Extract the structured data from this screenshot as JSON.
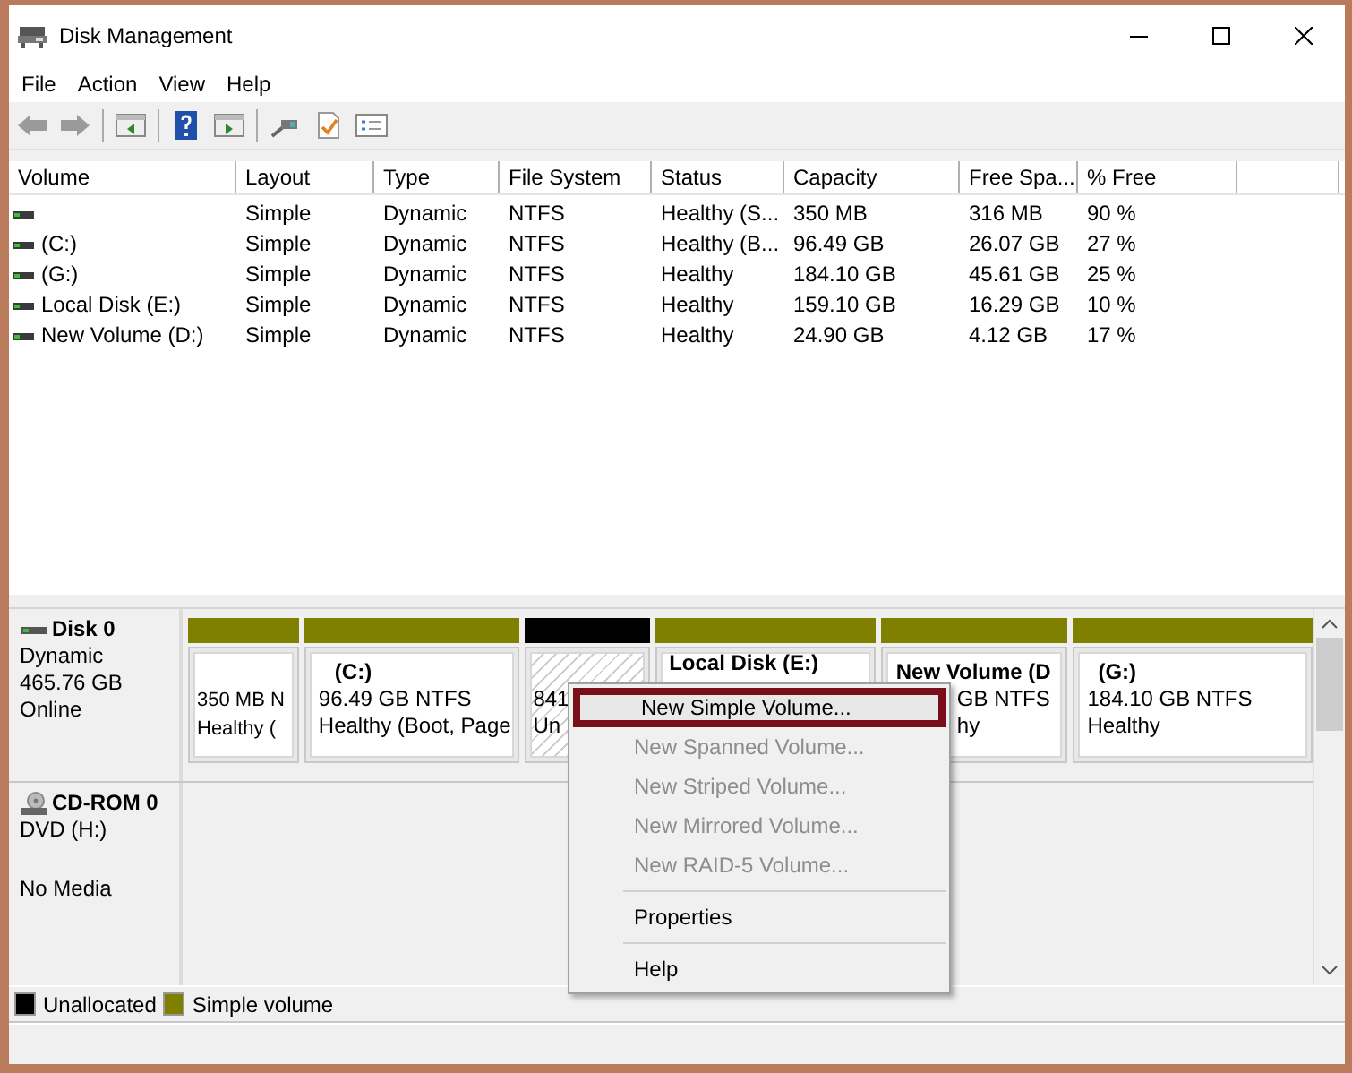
{
  "window": {
    "title": "Disk Management"
  },
  "menu": [
    "File",
    "Action",
    "View",
    "Help"
  ],
  "volume_list": {
    "columns": [
      "Volume",
      "Layout",
      "Type",
      "File System",
      "Status",
      "Capacity",
      "Free Spa...",
      "% Free"
    ],
    "rows": [
      {
        "layout": "Simple",
        "type": "Dynamic",
        "file_system": "NTFS",
        "status": "Healthy (S...",
        "capacity": "350 MB",
        "free_space": "316 MB",
        "percent_free": "90 %"
      },
      {
        "volume": " (C:)",
        "layout": "Simple",
        "type": "Dynamic",
        "file_system": "NTFS",
        "status": "Healthy (B...",
        "capacity": "96.49 GB",
        "free_space": "26.07 GB",
        "percent_free": "27 %"
      },
      {
        "volume": " (G:)",
        "layout": "Simple",
        "type": "Dynamic",
        "file_system": "NTFS",
        "status": "Healthy",
        "capacity": "184.10 GB",
        "free_space": "45.61 GB",
        "percent_free": "25 %"
      },
      {
        "volume": "Local Disk (E:)",
        "layout": "Simple",
        "type": "Dynamic",
        "file_system": "NTFS",
        "status": "Healthy",
        "capacity": "159.10 GB",
        "free_space": "16.29 GB",
        "percent_free": "10 %"
      },
      {
        "volume": "New Volume (D:)",
        "layout": "Simple",
        "type": "Dynamic",
        "file_system": "NTFS",
        "status": "Healthy",
        "capacity": "24.90 GB",
        "free_space": "4.12 GB",
        "percent_free": "17 %"
      }
    ]
  },
  "disks": [
    {
      "kind": "disk",
      "name": "Disk 0",
      "type": "Dynamic",
      "size": "465.76 GB",
      "status": "Online",
      "partitions": [
        {
          "kind": "simple",
          "lines": [
            "350 MB N",
            "Healthy ("
          ]
        },
        {
          "kind": "simple",
          "title": "(C:)",
          "lines": [
            "96.49 GB NTFS",
            "Healthy (Boot, Page"
          ]
        },
        {
          "kind": "unallocated",
          "lines": [
            "841",
            "Un"
          ]
        },
        {
          "kind": "simple",
          "title": "Local Disk  (E:)"
        },
        {
          "kind": "simple",
          "title": "New Volume  (D",
          "lines": [
            "GB NTFS",
            "hy"
          ]
        },
        {
          "kind": "simple",
          "title": "(G:)",
          "lines": [
            "184.10 GB NTFS",
            "Healthy"
          ]
        }
      ]
    },
    {
      "kind": "cdrom",
      "name": "CD-ROM 0",
      "type": "DVD (H:)",
      "status": "No Media"
    }
  ],
  "legend": [
    {
      "kind": "unallocated",
      "label": "Unallocated",
      "color": "#000000"
    },
    {
      "kind": "simple",
      "label": "Simple volume",
      "color": "#808000"
    }
  ],
  "context_menu": {
    "items": [
      {
        "kind": "item",
        "label": "New Simple Volume...",
        "disabled": false,
        "selected": true
      },
      {
        "kind": "item",
        "label": "New Spanned Volume...",
        "disabled": true,
        "selected": false
      },
      {
        "kind": "item",
        "label": "New Striped Volume...",
        "disabled": true,
        "selected": false
      },
      {
        "kind": "item",
        "label": "New Mirrored Volume...",
        "disabled": true,
        "selected": false
      },
      {
        "kind": "item",
        "label": "New RAID-5 Volume...",
        "disabled": true,
        "selected": false
      },
      {
        "kind": "separator"
      },
      {
        "kind": "item",
        "label": "Properties",
        "disabled": false,
        "selected": false
      },
      {
        "kind": "separator"
      },
      {
        "kind": "item",
        "label": "Help",
        "disabled": false,
        "selected": false
      }
    ]
  }
}
